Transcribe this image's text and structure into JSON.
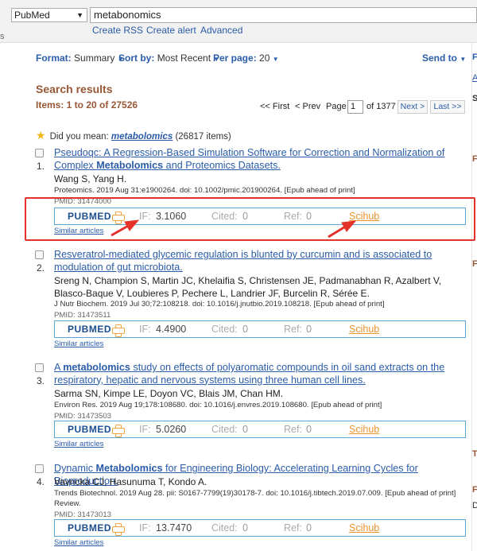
{
  "search": {
    "database": "PubMed",
    "query": "metabonomics",
    "links": [
      "Create RSS",
      "Create alert",
      "Advanced"
    ],
    "left_fragment": "s"
  },
  "display": {
    "format_label": "Format:",
    "format_value": "Summary",
    "sort_label": "Sort by:",
    "sort_value": "Most Recent",
    "perpage_label": "Per page:",
    "perpage_value": "20",
    "send_to": "Send to"
  },
  "results_header": {
    "title": "Search results",
    "items": "Items: 1 to 20 of 27526"
  },
  "pager": {
    "first": "<< First",
    "prev": "< Prev",
    "page_label": "Page",
    "page_value": "1",
    "of": "of 1377",
    "next": "Next >",
    "last": "Last >>"
  },
  "did_you_mean": {
    "prefix": "Did you mean:",
    "term": "metabolomics",
    "suffix": "(26817 items)"
  },
  "metrics_labels": {
    "pubmed": "PUBMED",
    "if": "IF:",
    "cited": "Cited:",
    "ref": "Ref:",
    "scihub": "Scihub",
    "similar": "Similar articles"
  },
  "results": [
    {
      "number": "1.",
      "title_parts": [
        "Pseudoqc: A Regression-Based Simulation Software for Correction and Normalization of Complex ",
        "Metabolomics",
        " and Proteomics Datasets."
      ],
      "authors": "Wang S, Yang H.",
      "journal": "Proteomics. 2019 Aug 31:e1900264. doi: 10.1002/pmic.201900264. [Epub ahead of print]",
      "pmid": "PMID: 31474000",
      "if": "3.1060",
      "cited": "0",
      "ref": "0"
    },
    {
      "number": "2.",
      "title_parts": [
        "Resveratrol-mediated glycemic regulation is blunted by curcumin and is associated to modulation of gut microbiota.",
        "",
        ""
      ],
      "authors": "Sreng N, Champion S, Martin JC, Khelaifia S, Christensen JE, Padmanabhan R, Azalbert V, Blasco-Baque V, Loubieres P, Pechere L, Landrier JF, Burcelin R, Sérée E.",
      "journal": "J Nutr Biochem. 2019 Jul 30;72:108218. doi: 10.1016/j.jnutbio.2019.108218. [Epub ahead of print]",
      "pmid": "PMID: 31473511",
      "if": "4.4900",
      "cited": "0",
      "ref": "0"
    },
    {
      "number": "3.",
      "title_parts": [
        "A ",
        "metabolomics",
        " study on effects of polyaromatic compounds in oil sand extracts on the respiratory, hepatic and nervous systems using three human cell lines."
      ],
      "authors": "Sarma SN, Kimpe LE, Doyon VC, Blais JM, Chan HM.",
      "journal": "Environ Res. 2019 Aug 19;178:108680. doi: 10.1016/j.envres.2019.108680. [Epub ahead of print]",
      "pmid": "PMID: 31473503",
      "if": "5.0260",
      "cited": "0",
      "ref": "0"
    },
    {
      "number": "4.",
      "title_parts": [
        "Dynamic ",
        "Metabolomics",
        " for Engineering Biology: Accelerating Learning Cycles for Bioproduction."
      ],
      "authors": "Vavricka CJ, Hasunuma T, Kondo A.",
      "journal": "Trends Biotechnol. 2019 Aug 28. pii: S0167-7799(19)30178-7. doi: 10.1016/j.tibtech.2019.07.009. [Epub ahead of print] Review.",
      "pmid": "PMID: 31473013",
      "if": "13.7470",
      "cited": "0",
      "ref": "0"
    }
  ],
  "right_fragments": [
    "F",
    "A",
    "S",
    "F",
    "F",
    "T",
    "F",
    "D"
  ],
  "colors": {
    "link": "#2a5ca8",
    "heading": "#985735",
    "scihub": "#e8942e",
    "highlight": "#e4322b",
    "box_border": "#5aa6d6"
  }
}
